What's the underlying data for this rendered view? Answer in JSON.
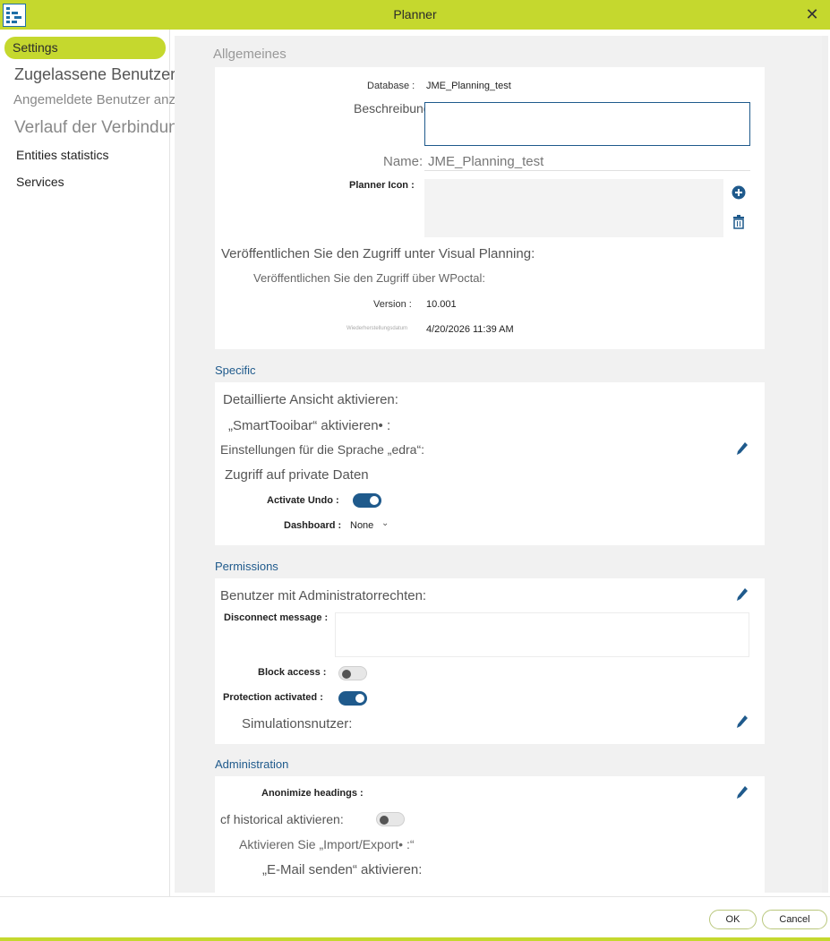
{
  "window": {
    "title": "Planner",
    "close_icon": "close-icon",
    "logo_icon": "planner-logo-icon"
  },
  "sidebar": {
    "items": [
      {
        "label": "Settings",
        "active": true
      },
      {
        "label": "Zugelassene Benutzer/Gruppen"
      },
      {
        "label": "Angemeldete Benutzer anzeigen"
      },
      {
        "label": "Verlauf der Verbindung"
      },
      {
        "label": "Entities statistics"
      },
      {
        "label": "Services"
      }
    ]
  },
  "general": {
    "heading": "Allgemeines",
    "database_label": "Database :",
    "database_value": "JME_Planning_test",
    "description_label": "Beschreibung:",
    "name_label": "Name:",
    "name_value": "JME_Planning_test",
    "icon_label": "Planner Icon :",
    "publish_vp": "Veröffentlichen Sie den Zugriff unter Visual Planning:",
    "publish_wp": "Veröffentlichen Sie den Zugriff über WPoctal:",
    "version_label": "Version :",
    "version_value": "10.001",
    "restore_label": "Wiederherstellungsdatum",
    "restore_value": "4/20/2026 11:39 AM"
  },
  "specific": {
    "heading": "Specific",
    "detailed_view": "Detaillierte Ansicht aktivieren:",
    "smarttoolbar": "„SmartTooibar“ aktivieren• :",
    "language": "Einstellungen für die Sprache „edra“:",
    "private_data": "Zugriff auf private Daten",
    "undo_label": "Activate Undo :",
    "undo_on": true,
    "dashboard_label": "Dashboard :",
    "dashboard_value": "None"
  },
  "permissions": {
    "heading": "Permissions",
    "admin_users": "Benutzer mit Administratorrechten:",
    "disconnect_label": "Disconnect message :",
    "block_label": "Block access :",
    "block_on": false,
    "protection_label": "Protection activated :",
    "protection_on": true,
    "sim_users": "Simulationsnutzer:"
  },
  "administration": {
    "heading": "Administration",
    "anonymize_label": "Anonimize headings :",
    "historical": "cf historical aktivieren:",
    "historical_on": false,
    "import_export": "Aktivieren Sie „Import/Export• :“",
    "email": "„E-Mail senden“ aktivieren:"
  },
  "footer": {
    "ok": "OK",
    "cancel": "Cancel"
  },
  "colors": {
    "accent": "#c5d82e",
    "primary": "#1f5a8c"
  }
}
